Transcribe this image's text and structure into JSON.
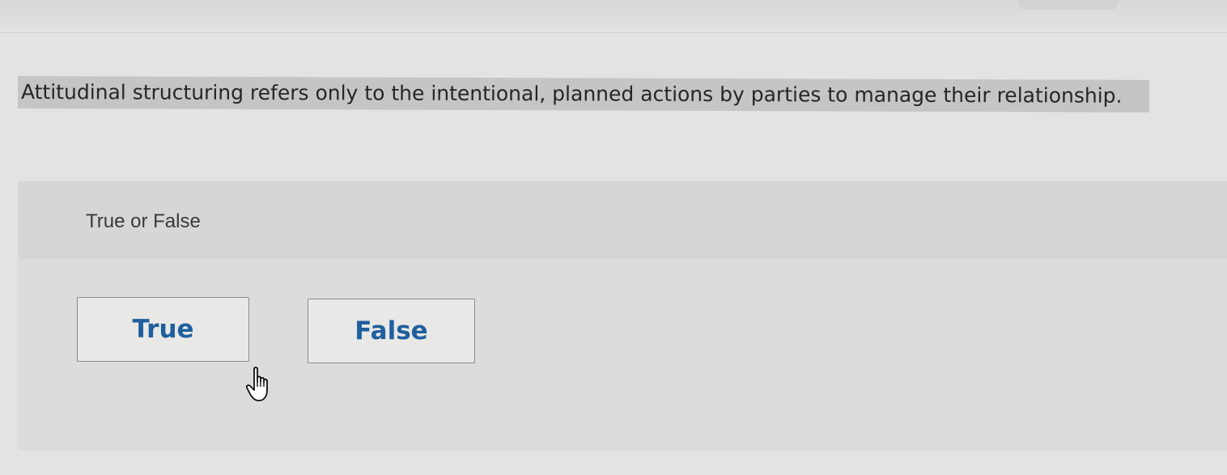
{
  "question": {
    "text": "Attitudinal structuring refers only to the intentional, planned actions by parties to manage their relationship."
  },
  "answer_area": {
    "prompt": "True or False",
    "choices": [
      {
        "label": "True"
      },
      {
        "label": "False"
      }
    ]
  },
  "cursor": {
    "icon": "hand-pointer-icon"
  },
  "colors": {
    "choice_text": "#1f5f9e",
    "highlight": "#c5c5c3",
    "panel": "#dcdcda"
  }
}
